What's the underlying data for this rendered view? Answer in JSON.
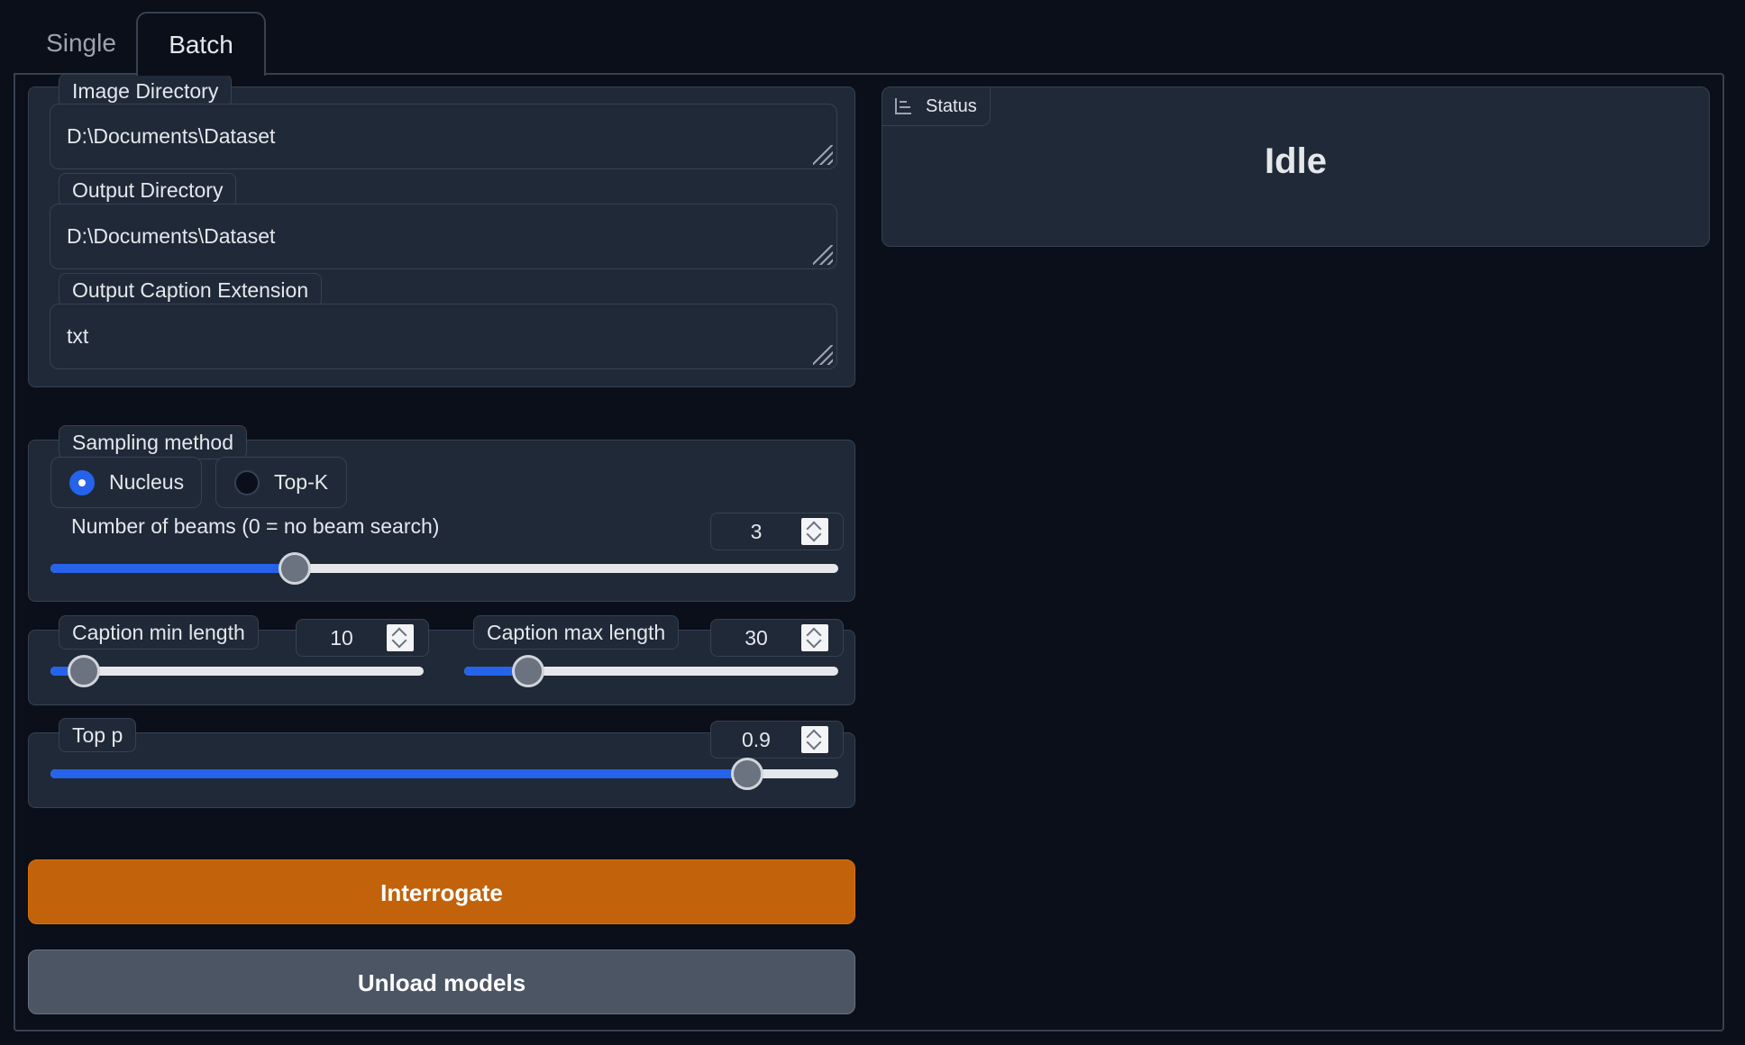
{
  "tabs": {
    "single": "Single",
    "batch": "Batch"
  },
  "batch": {
    "image_directory": {
      "label": "Image Directory",
      "value": "D:\\Documents\\Dataset"
    },
    "output_directory": {
      "label": "Output Directory",
      "value": "D:\\Documents\\Dataset"
    },
    "output_caption_extension": {
      "label": "Output Caption Extension",
      "value": "txt"
    }
  },
  "sampling": {
    "label": "Sampling method",
    "options": [
      "Nucleus",
      "Top-K"
    ],
    "selected": "Nucleus"
  },
  "beams": {
    "label": "Number of beams (0 = no beam search)",
    "value": "3",
    "fraction": 0.31
  },
  "caption_min": {
    "label": "Caption min length",
    "value": "10",
    "fraction": 0.09
  },
  "caption_max": {
    "label": "Caption max length",
    "value": "30",
    "fraction": 0.17
  },
  "top_p": {
    "label": "Top p",
    "value": "0.9",
    "fraction": 0.885
  },
  "buttons": {
    "interrogate": "Interrogate",
    "unload": "Unload models"
  },
  "status": {
    "label": "Status",
    "value": "Idle"
  },
  "colors": {
    "accent": "#2563eb",
    "primary_button": "#c2620a",
    "secondary_button": "#4b5563",
    "background": "#0b0f19"
  }
}
